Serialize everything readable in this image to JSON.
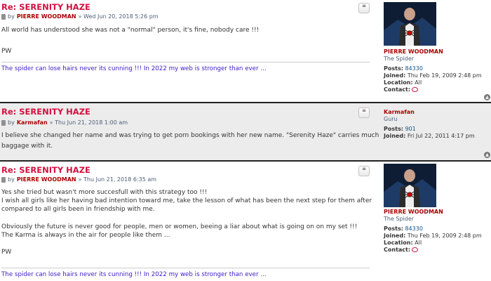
{
  "posts": [
    {
      "title": "Re: SERENITY HAZE",
      "quote_glyph": "❝",
      "by": "by",
      "author": "PIERRE WOODMAN",
      "date": "» Wed Jun 20, 2018 5:26 pm",
      "lines": [
        "All world has understood she was not a \"normal\" person, it's fine, nobody care !!!",
        "",
        "PW"
      ],
      "signature": "The spider can lose hairs never its cunning !!! In 2022 my web is stronger than ever ...",
      "profile": {
        "name": "PIERRE WOODMAN",
        "rank": "The Spider",
        "posts_label": "Posts:",
        "posts_value": "84330",
        "joined_label": "Joined:",
        "joined_value": "Thu Feb 19, 2009 2:48 pm",
        "location_label": "Location:",
        "location_value": "All",
        "contact_label": "Contact:"
      }
    },
    {
      "title": "Re: SERENITY HAZE",
      "quote_glyph": "❝",
      "by": "by",
      "author": "Karmafan",
      "date": "» Thu Jun 21, 2018 1:00 am",
      "lines": [
        "I believe she changed her name and was trying to get porn bookings with her new name. \"Serenity Haze\" carries much",
        "baggage with it."
      ],
      "profile": {
        "name": "Karmafan",
        "rank": "Guru",
        "posts_label": "Posts:",
        "posts_value": "901",
        "joined_label": "Joined:",
        "joined_value": "Fri Jul 22, 2011 4:17 pm"
      }
    },
    {
      "title": "Re: SERENITY HAZE",
      "quote_glyph": "❝",
      "by": "by",
      "author": "PIERRE WOODMAN",
      "date": "» Thu Jun 21, 2018 6:35 am",
      "lines": [
        "Yes she tried but wasn't more succesfull with this strategy too !!!",
        "I wish all girls like her having bad intention toward me, take the lesson of what has been the next step for them after",
        "compared to all girls been in friendship with me.",
        "",
        "Obviously the future is never good for people, men or women, beeing a liar about what is going on on my set !!!",
        "The Karma is always in the air for people like them ...",
        "",
        "PW"
      ],
      "signature": "The spider can lose hairs never its cunning !!! In 2022 my web is stronger than ever ...",
      "profile": {
        "name": "PIERRE WOODMAN",
        "rank": "The Spider",
        "posts_label": "Posts:",
        "posts_value": "84330",
        "joined_label": "Joined:",
        "joined_value": "Thu Feb 19, 2009 2:48 pm",
        "location_label": "Location:",
        "location_value": "All",
        "contact_label": "Contact:"
      }
    }
  ],
  "icons": {
    "quote": "quote-icon",
    "post": "post-icon",
    "top": "back-to-top-icon",
    "contact": "contact-icon"
  },
  "top_glyph": "▲",
  "colors": {
    "title": "#d31141",
    "username": "#aa0000",
    "signature": "#4020c8",
    "alt_bg": "#ececec"
  }
}
